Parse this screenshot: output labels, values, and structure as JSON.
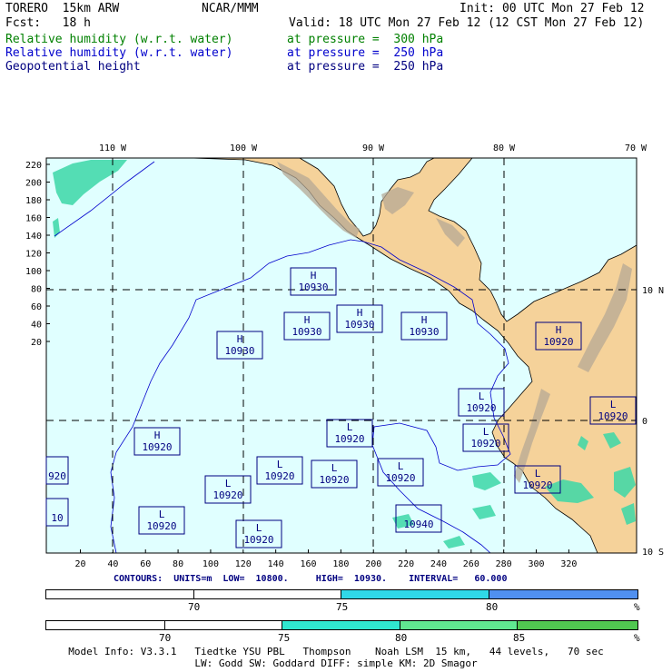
{
  "header": {
    "line1_left": "TORERO  15km ARW",
    "line1_mid": "NCAR/MMM",
    "line1_right": "Init: 00 UTC Mon 27 Feb 12",
    "line2_left": "Fcst:   18 h",
    "line2_right": "Valid: 18 UTC Mon 27 Feb 12 (12 CST Mon 27 Feb 12)",
    "fields": [
      {
        "name": "Relative humidity (w.r.t. water)",
        "level": "at pressure =  300 hPa",
        "color": "#008000"
      },
      {
        "name": "Relative humidity (w.r.t. water)",
        "level": "at pressure =  250 hPa",
        "color": "#0000cc"
      },
      {
        "name": "Geopotential height",
        "level": "at pressure =  250 hPa",
        "color": "#000080"
      }
    ]
  },
  "map": {
    "top_lon_labels": [
      "110 W",
      "100 W",
      "90 W",
      "80 W",
      "70 W"
    ],
    "right_lat_labels": [
      "10 N",
      "0",
      "10 S"
    ],
    "left_ticks": [
      "220",
      "200",
      "180",
      "160",
      "140",
      "120",
      "100",
      "80",
      "60",
      "40",
      "20"
    ],
    "bottom_ticks": [
      "20",
      "40",
      "60",
      "80",
      "100",
      "120",
      "140",
      "160",
      "180",
      "200",
      "220",
      "240",
      "260",
      "280",
      "300",
      "320"
    ],
    "ocean_color": "#e0ffff",
    "land_color": "#f5d29a",
    "height_labels": [
      {
        "letter": "H",
        "value": "10930"
      },
      {
        "letter": "H",
        "value": "10930"
      },
      {
        "letter": "H",
        "value": "10930"
      },
      {
        "letter": "H",
        "value": "10930"
      },
      {
        "letter": "H",
        "value": "10930"
      },
      {
        "letter": "H",
        "value": "10920"
      },
      {
        "letter": "L",
        "value": "10920"
      },
      {
        "letter": "L",
        "value": "10920"
      },
      {
        "letter": "H",
        "value": "10920"
      },
      {
        "letter": "L",
        "value": "10920"
      },
      {
        "letter": "L",
        "value": "10920"
      },
      {
        "letter": "L",
        "value": "10920"
      },
      {
        "letter": "L",
        "value": "10920"
      },
      {
        "letter": "L",
        "value": "10920"
      },
      {
        "letter": "L",
        "value": "10920"
      },
      {
        "letter": "",
        "value": "10940"
      },
      {
        "letter": "L",
        "value": "10920"
      },
      {
        "letter": "L",
        "value": "10920"
      },
      {
        "letter": "L",
        "value": "10920"
      },
      {
        "letter": "",
        "value": "920"
      },
      {
        "letter": "",
        "value": "10"
      }
    ]
  },
  "contours": {
    "text": "CONTOURS:  UNITS=m  LOW=  10800.     HIGH=  10930.    INTERVAL=   60.000"
  },
  "colorbar_300": {
    "labels": [
      "70",
      "75",
      "80",
      "%"
    ],
    "colors": [
      "#ffffff",
      "#ffffff",
      "#30d8e8",
      "#5090f0"
    ]
  },
  "colorbar_250": {
    "labels": [
      "70",
      "75",
      "80",
      "85",
      "%"
    ],
    "colors": [
      "#ffffff",
      "#ffffff",
      "#30e8d0",
      "#60e890",
      "#50c850"
    ]
  },
  "footer": {
    "line1": "Model Info: V3.3.1   Tiedtke YSU PBL   Thompson    Noah LSM  15 km,   44 levels,   70 sec",
    "line2": "LW: Godd SW: Goddard DIFF: simple KM: 2D Smagor"
  }
}
